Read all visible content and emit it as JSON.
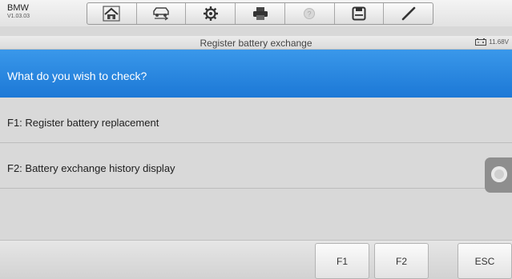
{
  "header": {
    "app_name": "BMW",
    "version": "V1.03.03"
  },
  "toolbar": {
    "buttons": [
      {
        "icon": "home-icon"
      },
      {
        "icon": "vehicle-swap-icon"
      },
      {
        "icon": "settings-gear-icon"
      },
      {
        "icon": "print-icon"
      },
      {
        "icon": "help-icon"
      },
      {
        "icon": "save-icon"
      },
      {
        "icon": "pen-icon"
      }
    ]
  },
  "subheader": {
    "title": "Register battery exchange",
    "battery_voltage": "11.68V"
  },
  "main": {
    "question": "What do you wish to check?",
    "options": [
      {
        "label": "F1: Register battery replacement"
      },
      {
        "label": "F2: Battery exchange history display"
      }
    ]
  },
  "footer": {
    "f1_label": "F1",
    "f2_label": "F2",
    "esc_label": "ESC"
  },
  "colors": {
    "accent": "#2a88e2",
    "background": "#d9d9d9"
  }
}
